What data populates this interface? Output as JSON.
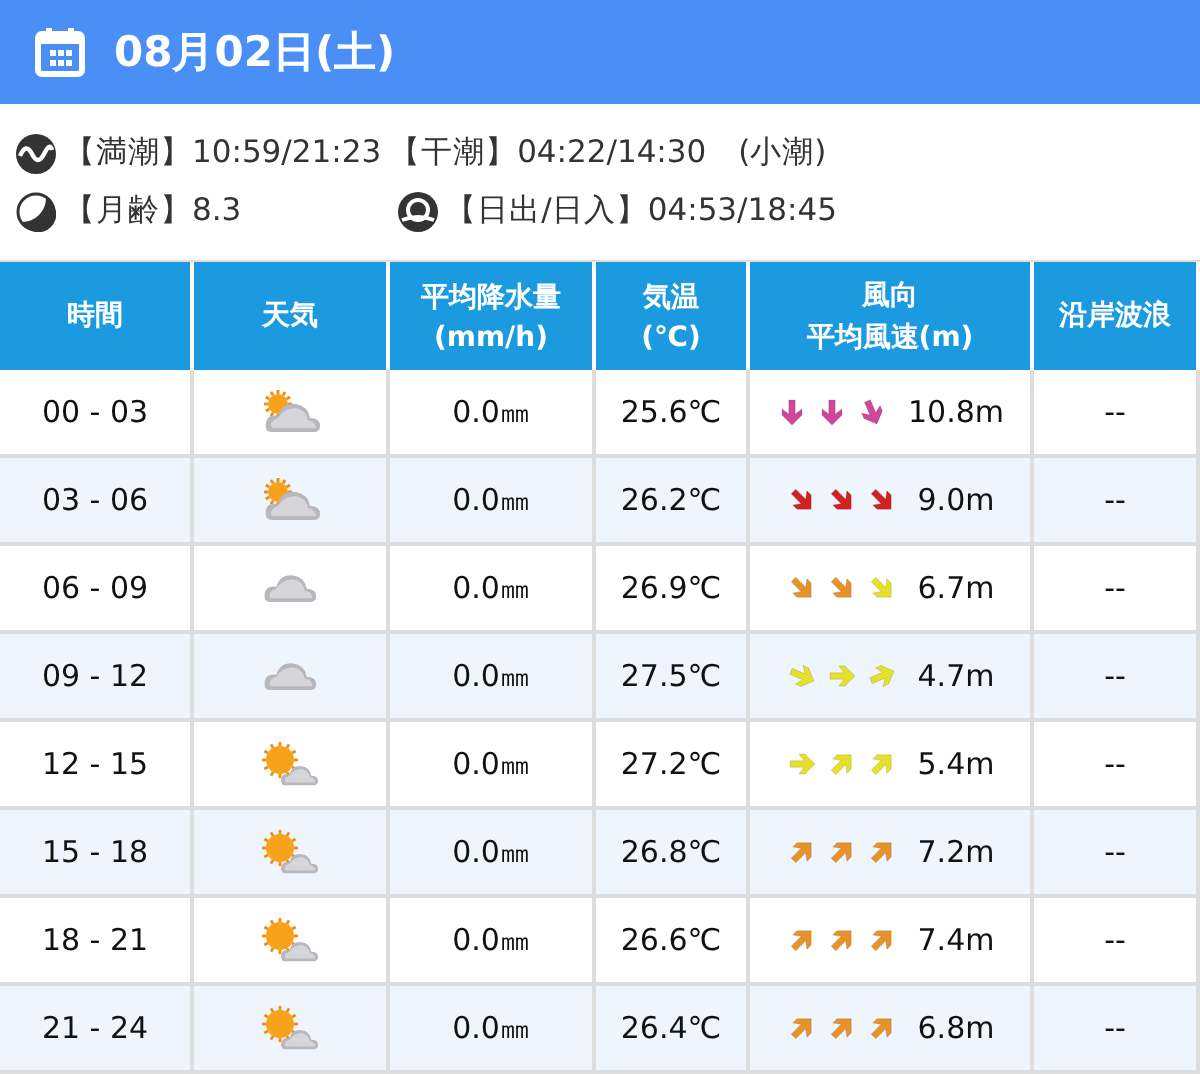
{
  "header": {
    "date": "08月02日(土)"
  },
  "info": {
    "tide": [
      "【満潮】10:59/21:23",
      "【干潮】04:22/14:30",
      "(小潮)"
    ],
    "moon_age": "【月齢】8.3",
    "sun": "【日出/日入】04:53/18:45"
  },
  "table": {
    "columns": [
      {
        "lines": [
          "時間"
        ]
      },
      {
        "lines": [
          "天気"
        ]
      },
      {
        "lines": [
          "平均降水量",
          "(mm/h)"
        ]
      },
      {
        "lines": [
          "気温",
          "(℃)"
        ]
      },
      {
        "lines": [
          "風向",
          "平均風速(m)"
        ]
      },
      {
        "lines": [
          "沿岸波浪"
        ]
      }
    ],
    "rows": [
      {
        "time": "00 - 03",
        "kind": "cloudy-sun",
        "rain": "0.0㎜",
        "temp": "25.6℃",
        "arrows": [
          {
            "kind": "S",
            "color": "#d0479a"
          },
          {
            "kind": "S",
            "color": "#d0479a"
          },
          {
            "kind": "SSE",
            "color": "#d0479a"
          }
        ],
        "wind": "10.8m",
        "waves": "--"
      },
      {
        "time": "03 - 06",
        "kind": "cloudy-sun",
        "rain": "0.0㎜",
        "temp": "26.2℃",
        "arrows": [
          {
            "kind": "SE",
            "color": "#d42020"
          },
          {
            "kind": "SE",
            "color": "#d42020"
          },
          {
            "kind": "SE",
            "color": "#d42020"
          }
        ],
        "wind": "9.0m",
        "waves": "--"
      },
      {
        "time": "06 - 09",
        "kind": "cloudy",
        "rain": "0.0㎜",
        "temp": "26.9℃",
        "arrows": [
          {
            "kind": "SE",
            "color": "#e8922a"
          },
          {
            "kind": "SE",
            "color": "#e8922a"
          },
          {
            "kind": "SE",
            "color": "#e6e02a"
          }
        ],
        "wind": "6.7m",
        "waves": "--"
      },
      {
        "time": "09 - 12",
        "kind": "cloudy",
        "rain": "0.0㎜",
        "temp": "27.5℃",
        "arrows": [
          {
            "kind": "ESE",
            "color": "#e6e02a"
          },
          {
            "kind": "E",
            "color": "#e6e02a"
          },
          {
            "kind": "ENE",
            "color": "#e6e02a"
          }
        ],
        "wind": "4.7m",
        "waves": "--"
      },
      {
        "time": "12 - 15",
        "kind": "sun-cloudy",
        "rain": "0.0㎜",
        "temp": "27.2℃",
        "arrows": [
          {
            "kind": "E",
            "color": "#e6e02a"
          },
          {
            "kind": "NE",
            "color": "#e6e02a"
          },
          {
            "kind": "NE",
            "color": "#e6e02a"
          }
        ],
        "wind": "5.4m",
        "waves": "--"
      },
      {
        "time": "15 - 18",
        "kind": "sun-cloudy",
        "rain": "0.0㎜",
        "temp": "26.8℃",
        "arrows": [
          {
            "kind": "NE",
            "color": "#e8922a"
          },
          {
            "kind": "NE",
            "color": "#e8922a"
          },
          {
            "kind": "NE",
            "color": "#e8922a"
          }
        ],
        "wind": "7.2m",
        "waves": "--"
      },
      {
        "time": "18 - 21",
        "kind": "sun-cloudy",
        "rain": "0.0㎜",
        "temp": "26.6℃",
        "arrows": [
          {
            "kind": "NE",
            "color": "#e8922a"
          },
          {
            "kind": "NE",
            "color": "#e8922a"
          },
          {
            "kind": "NE",
            "color": "#e8922a"
          }
        ],
        "wind": "7.4m",
        "waves": "--"
      },
      {
        "time": "21 - 24",
        "kind": "sun-cloudy",
        "rain": "0.0㎜",
        "temp": "26.4℃",
        "arrows": [
          {
            "kind": "NE",
            "color": "#e8922a"
          },
          {
            "kind": "NE",
            "color": "#e8922a"
          },
          {
            "kind": "NE",
            "color": "#e8922a"
          }
        ],
        "wind": "6.8m",
        "waves": "--"
      }
    ]
  }
}
